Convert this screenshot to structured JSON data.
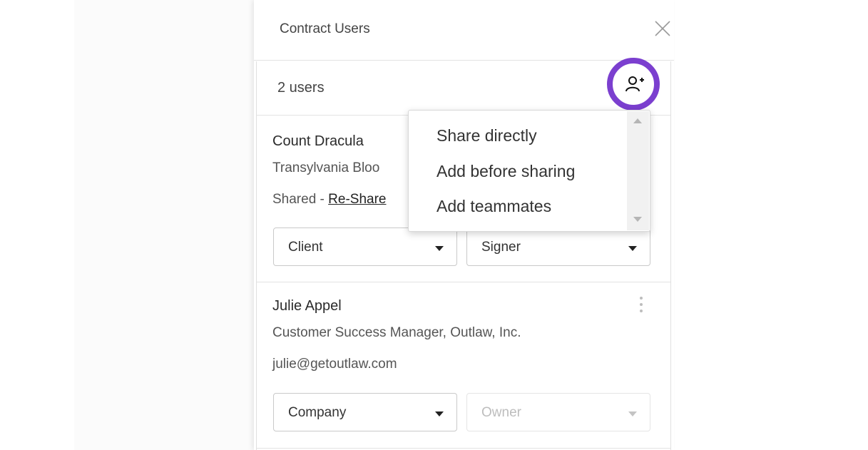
{
  "panel": {
    "title": "Contract Users",
    "close_icon": "close-icon"
  },
  "users_header": {
    "count_text": "2 users",
    "add_user_icon": "person-plus-icon",
    "highlight_color": "#7b3fcf"
  },
  "users": [
    {
      "name": "Count Dracula",
      "company_line": "Transylvania Bloo",
      "status_prefix": "Shared - ",
      "reshare_label": "Re-Share",
      "party_select": "Client",
      "role_select": "Signer"
    },
    {
      "name": "Julie Appel",
      "company_line": "Customer Success Manager, Outlaw, Inc.",
      "email": "julie@getoutlaw.com",
      "party_select": "Company",
      "role_select": "Owner",
      "menu_icon": "more-vertical-icon"
    }
  ],
  "add_menu": {
    "items": [
      "Share directly",
      "Add before sharing",
      "Add teammates"
    ]
  }
}
